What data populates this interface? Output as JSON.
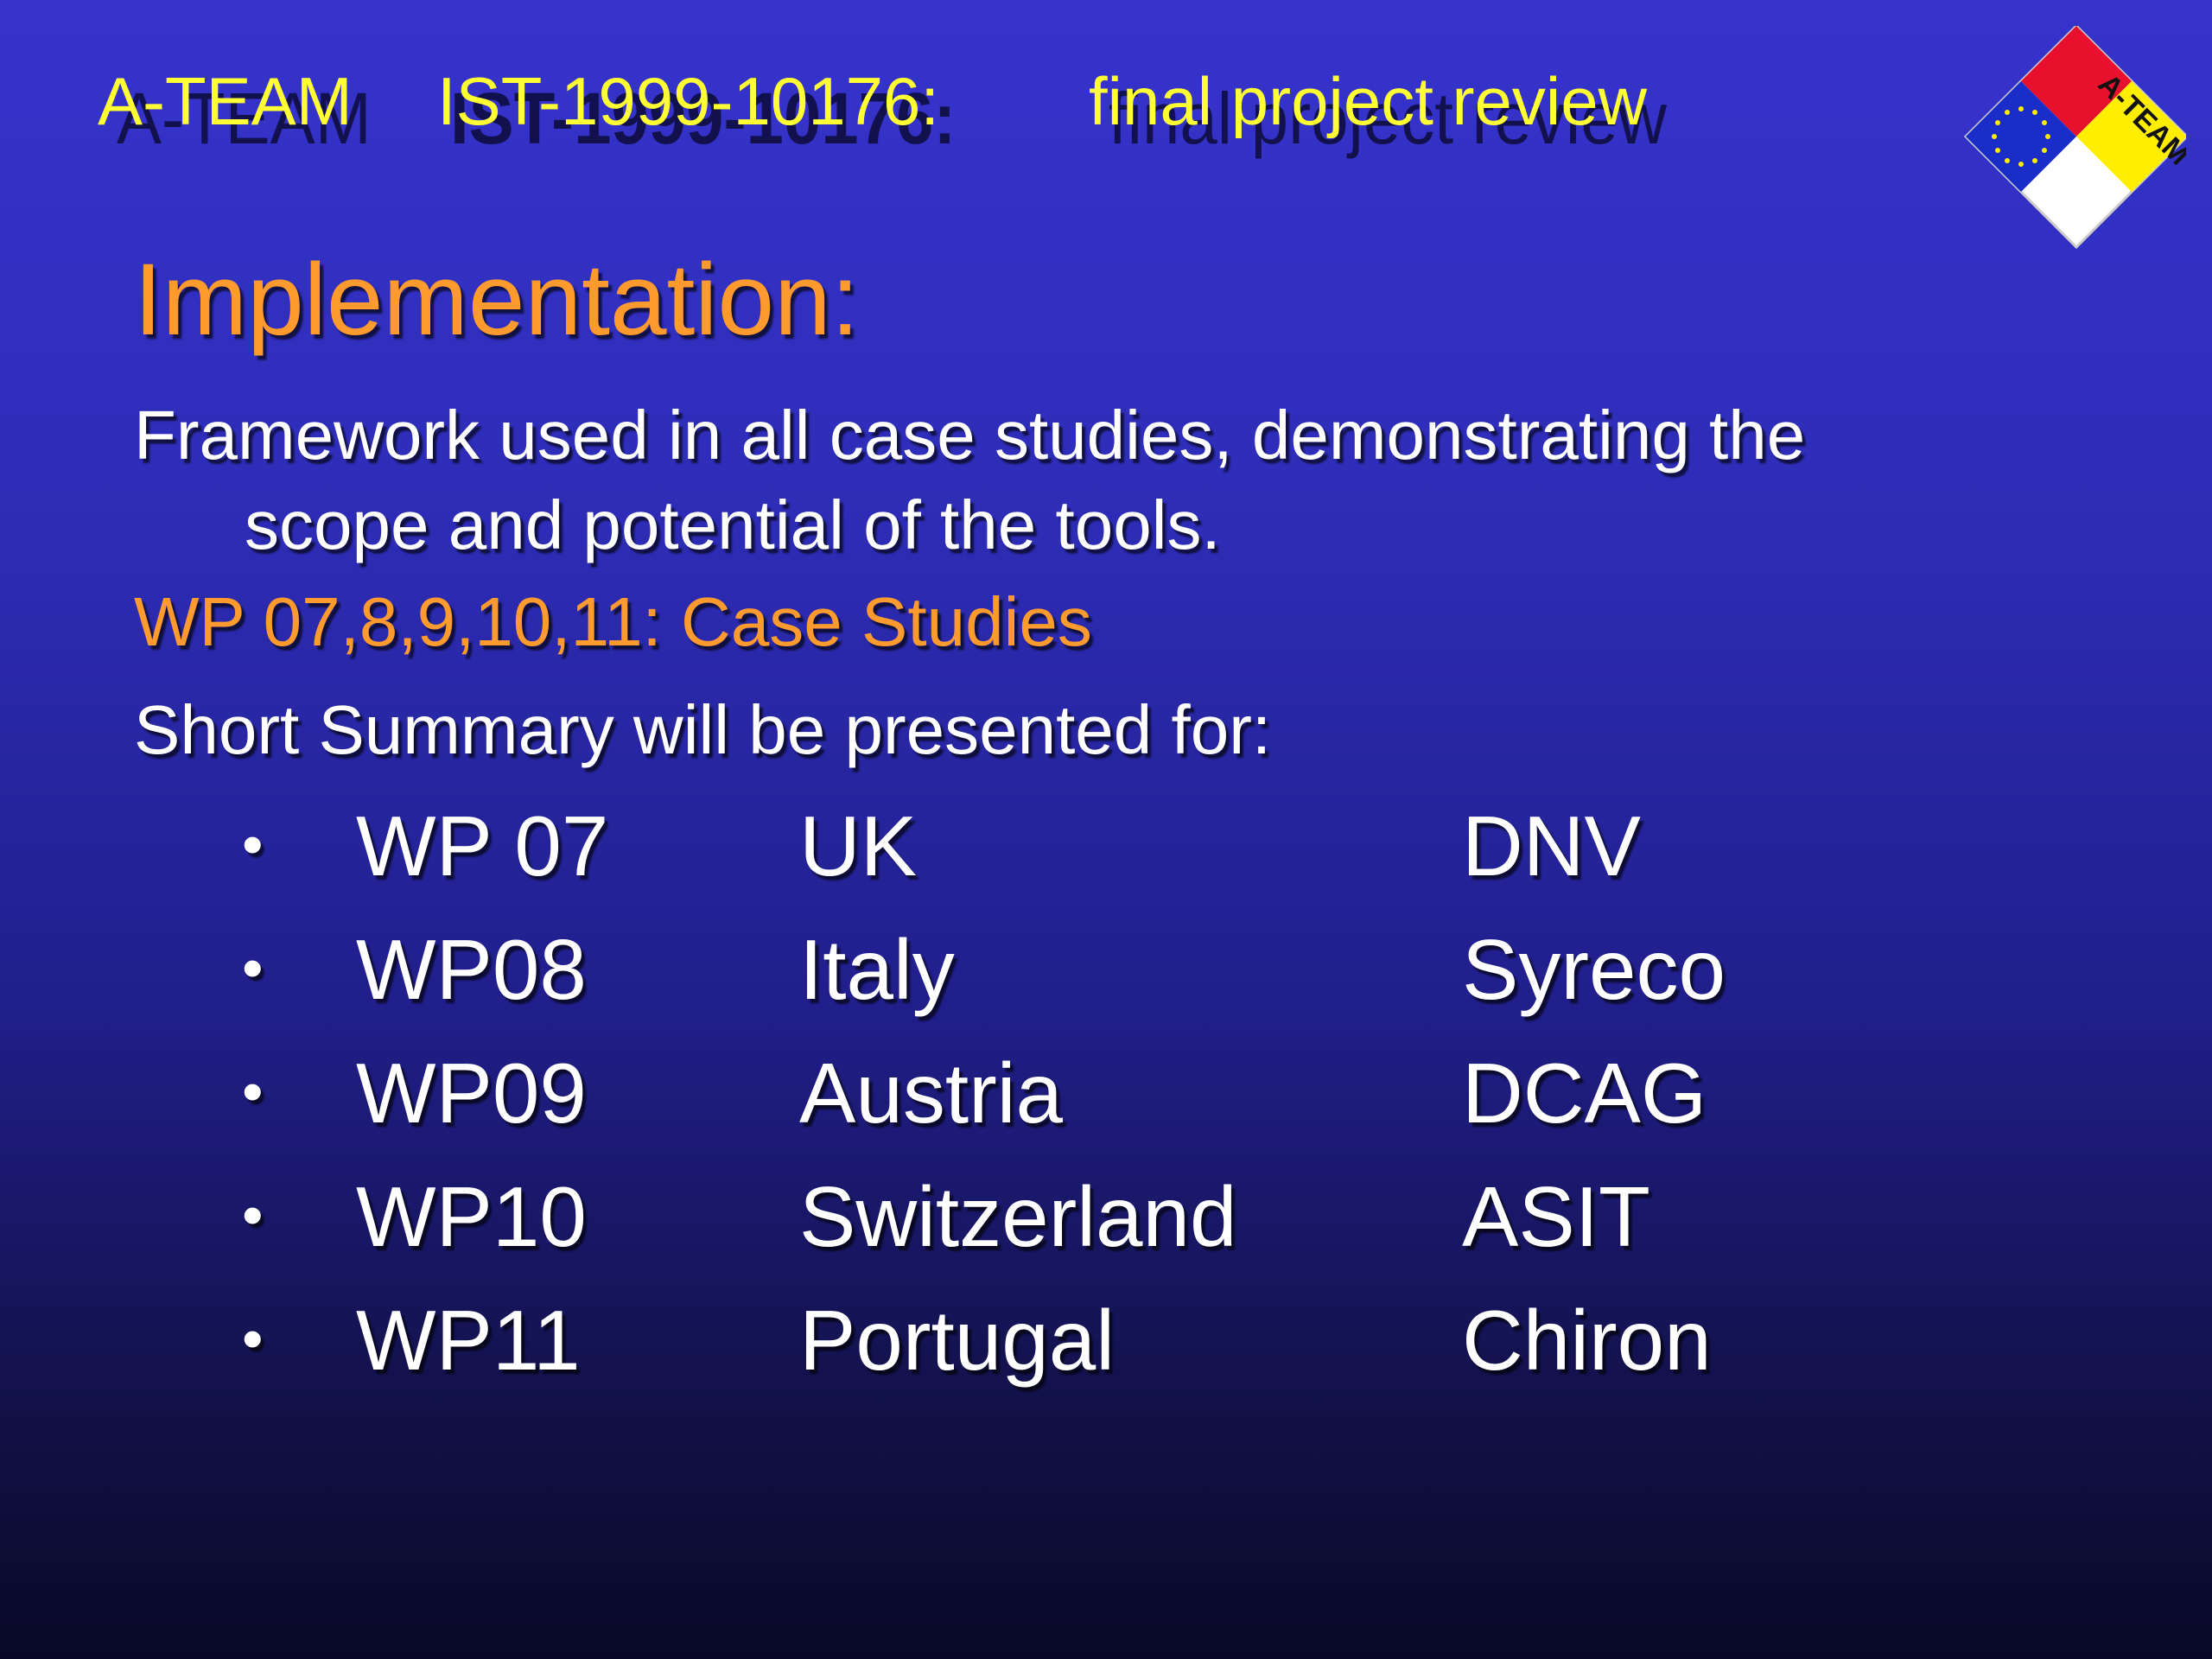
{
  "header": {
    "part1": "A-TEAM",
    "part2": "IST-1999-10176:",
    "part3": "final project review"
  },
  "logo": {
    "text": "A-TEAM",
    "colors": [
      "#e8112d",
      "#ffee00",
      "#1a2dc8",
      "#ffffff"
    ]
  },
  "slide": {
    "title": "Implementation:",
    "paragraph_line1": "Framework used in all case studies, demonstrating the",
    "paragraph_line2": "scope and potential of the tools.",
    "wp_heading": "WP 07,8,9,10,11: Case Studies",
    "summary_intro": "Short Summary will be presented for:",
    "bullet_char": "•",
    "items": [
      {
        "wp": "WP 07",
        "country": "UK",
        "org": "DNV"
      },
      {
        "wp": "WP08",
        "country": "Italy",
        "org": "Syreco"
      },
      {
        "wp": "WP09",
        "country": "Austria",
        "org": "DCAG"
      },
      {
        "wp": "WP10",
        "country": "Switzerland",
        "org": "ASIT"
      },
      {
        "wp": "WP11",
        "country": "Portugal",
        "org": "Chiron"
      }
    ]
  },
  "colors": {
    "title": "#ff9a2e",
    "header": "#ffff33",
    "body_text": "#ffffff"
  }
}
